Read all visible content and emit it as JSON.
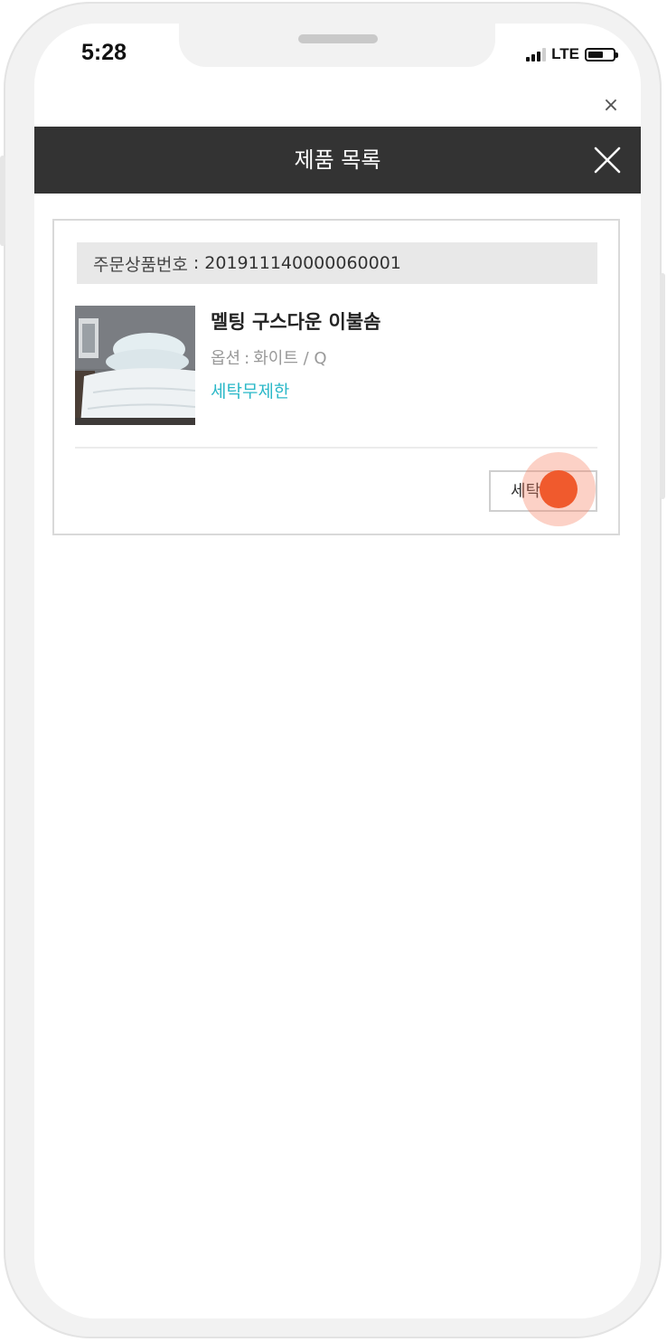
{
  "status_bar": {
    "time": "5:28",
    "network": "LTE"
  },
  "header": {
    "title": "제품 목록",
    "close_icon": "close-icon",
    "outer_close_symbol": "×"
  },
  "order": {
    "label": "주문상품번호",
    "separator": ":",
    "number": "201911140000060001"
  },
  "product": {
    "name": "멜팅 구스다운 이불솜",
    "option_label": "옵션",
    "option_separator": ":",
    "option_value": "화이트 / Q",
    "tag": "세탁무제한",
    "image_icon": "bedding-photo"
  },
  "actions": {
    "request_laundry": "세탁 신청"
  },
  "colors": {
    "header_bg": "#333333",
    "tag": "#2bb8c8",
    "tap_indicator": "#f05a2d"
  }
}
